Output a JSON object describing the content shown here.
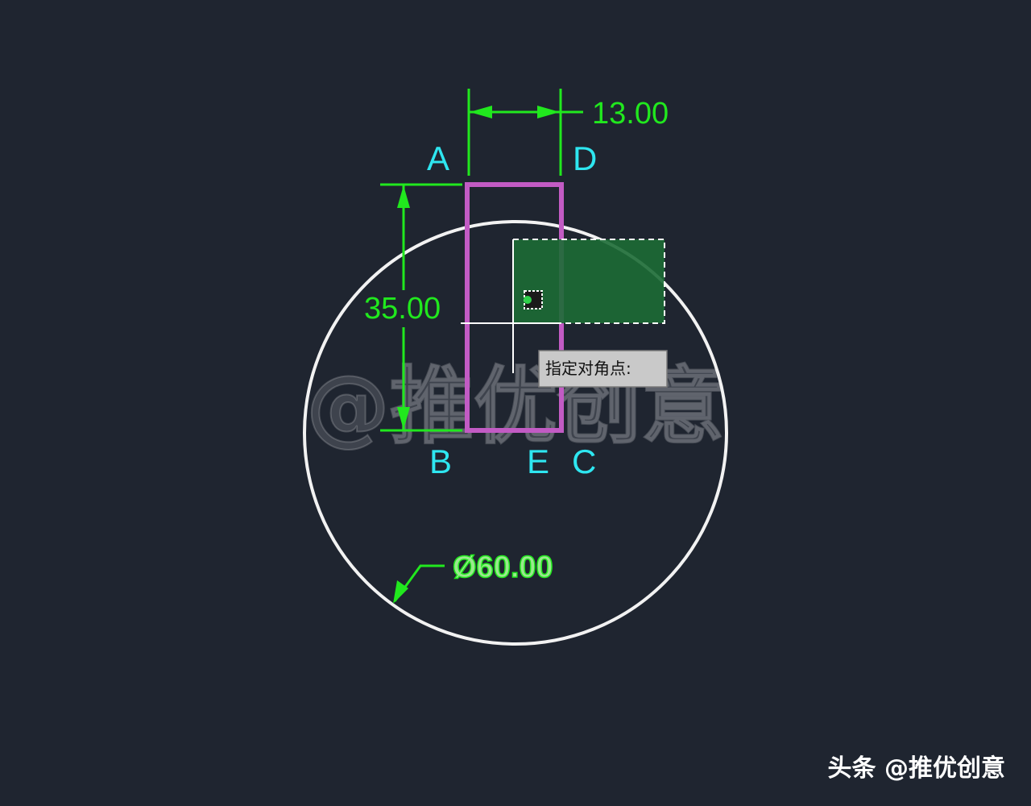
{
  "colors": {
    "background": "#1f2530",
    "dimension": "#21e81e",
    "point_label": "#2ee6f0",
    "rectangle": "#c25bc4",
    "circle": "#f2f2f2",
    "selection_fill": "#1c6b35"
  },
  "dimensions": {
    "width": "13.00",
    "height": "35.00",
    "diameter": "Ø60.00"
  },
  "points": {
    "a": "A",
    "b": "B",
    "c": "C",
    "d": "D",
    "e": "E"
  },
  "tooltip": {
    "prompt": "指定对角点:"
  },
  "watermark": {
    "text": "@推优创意"
  },
  "credit": {
    "text": "头条 @推优创意"
  },
  "icons": {
    "osnap_marker": "snap-marker-icon",
    "crosshair": "crosshair-cursor-icon"
  }
}
